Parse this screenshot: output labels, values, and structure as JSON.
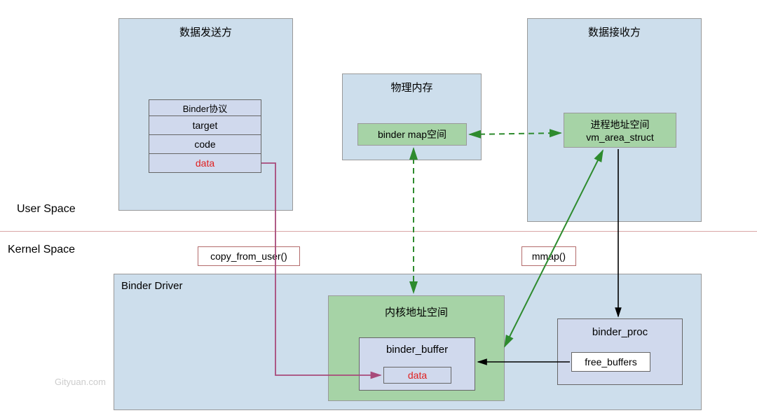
{
  "regions": {
    "user_space": "User Space",
    "kernel_space": "Kernel Space"
  },
  "sender": {
    "title": "数据发送方",
    "protocol_header": "Binder协议",
    "rows": [
      "target",
      "code",
      "data"
    ]
  },
  "physical_memory": {
    "title": "物理内存",
    "item": "binder map空间"
  },
  "receiver": {
    "title": "数据接收方",
    "addr_space_line1": "进程地址空间",
    "addr_space_line2": "vm_area_struct"
  },
  "driver": {
    "title": "Binder Driver",
    "kernel_addr_title": "内核地址空间",
    "binder_buffer": "binder_buffer",
    "data": "data",
    "binder_proc": "binder_proc",
    "free_buffers": "free_buffers"
  },
  "calls": {
    "copy_from_user": "copy_from_user()",
    "mmap": "mmap()"
  },
  "watermark": "Gityuan.com"
}
